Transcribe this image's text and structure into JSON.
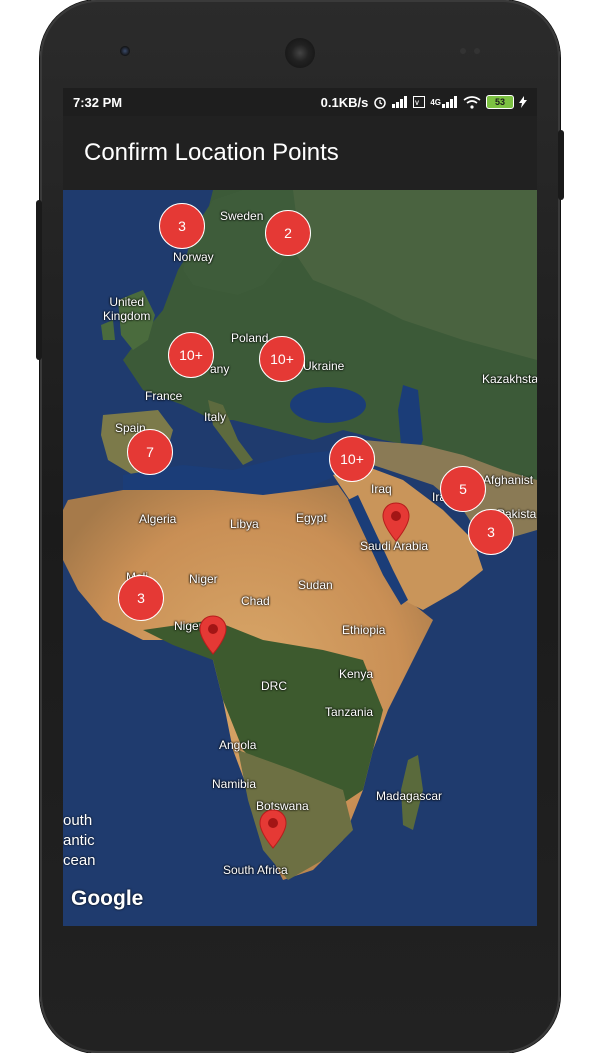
{
  "status_bar": {
    "time": "7:32 PM",
    "speed": "0.1KB/s",
    "network_label": "4G",
    "battery": "53"
  },
  "app_bar": {
    "title": "Confirm Location Points"
  },
  "map": {
    "provider_logo": "Google",
    "ocean_text": [
      "outh",
      "antic",
      "cean"
    ],
    "labels": {
      "sweden": "Sweden",
      "norway": "Norway",
      "uk": "United\nKingdom",
      "poland": "Poland",
      "ukraine": "Ukraine",
      "germany": "any",
      "france": "France",
      "kazakhstan": "Kazakhsta",
      "italy": "Italy",
      "spain": "Spain",
      "iraq": "Iraq",
      "iran": "Ira",
      "afghanistan": "Afghanist",
      "pakistan": "Pakista",
      "algeria": "Algeria",
      "libya": "Libya",
      "egypt": "Egypt",
      "saudi": "Saudi Arabia",
      "mali": "Mali",
      "niger": "Niger",
      "chad": "Chad",
      "sudan": "Sudan",
      "nigeria": "Nigeria",
      "ethiopia": "Ethiopia",
      "drc": "DRC",
      "kenya": "Kenya",
      "tanzania": "Tanzania",
      "angola": "Angola",
      "namibia": "Namibia",
      "botswana": "Botswana",
      "madagascar": "Madagascar",
      "south_africa": "South Africa"
    },
    "clusters": {
      "norway": "3",
      "sweden": "2",
      "germany": "10+",
      "ukraine": "10+",
      "spain": "7",
      "turkey": "10+",
      "iran": "5",
      "pakistan": "3",
      "mali": "3"
    },
    "colors": {
      "cluster": "#e53935",
      "pin": "#e53935"
    }
  }
}
